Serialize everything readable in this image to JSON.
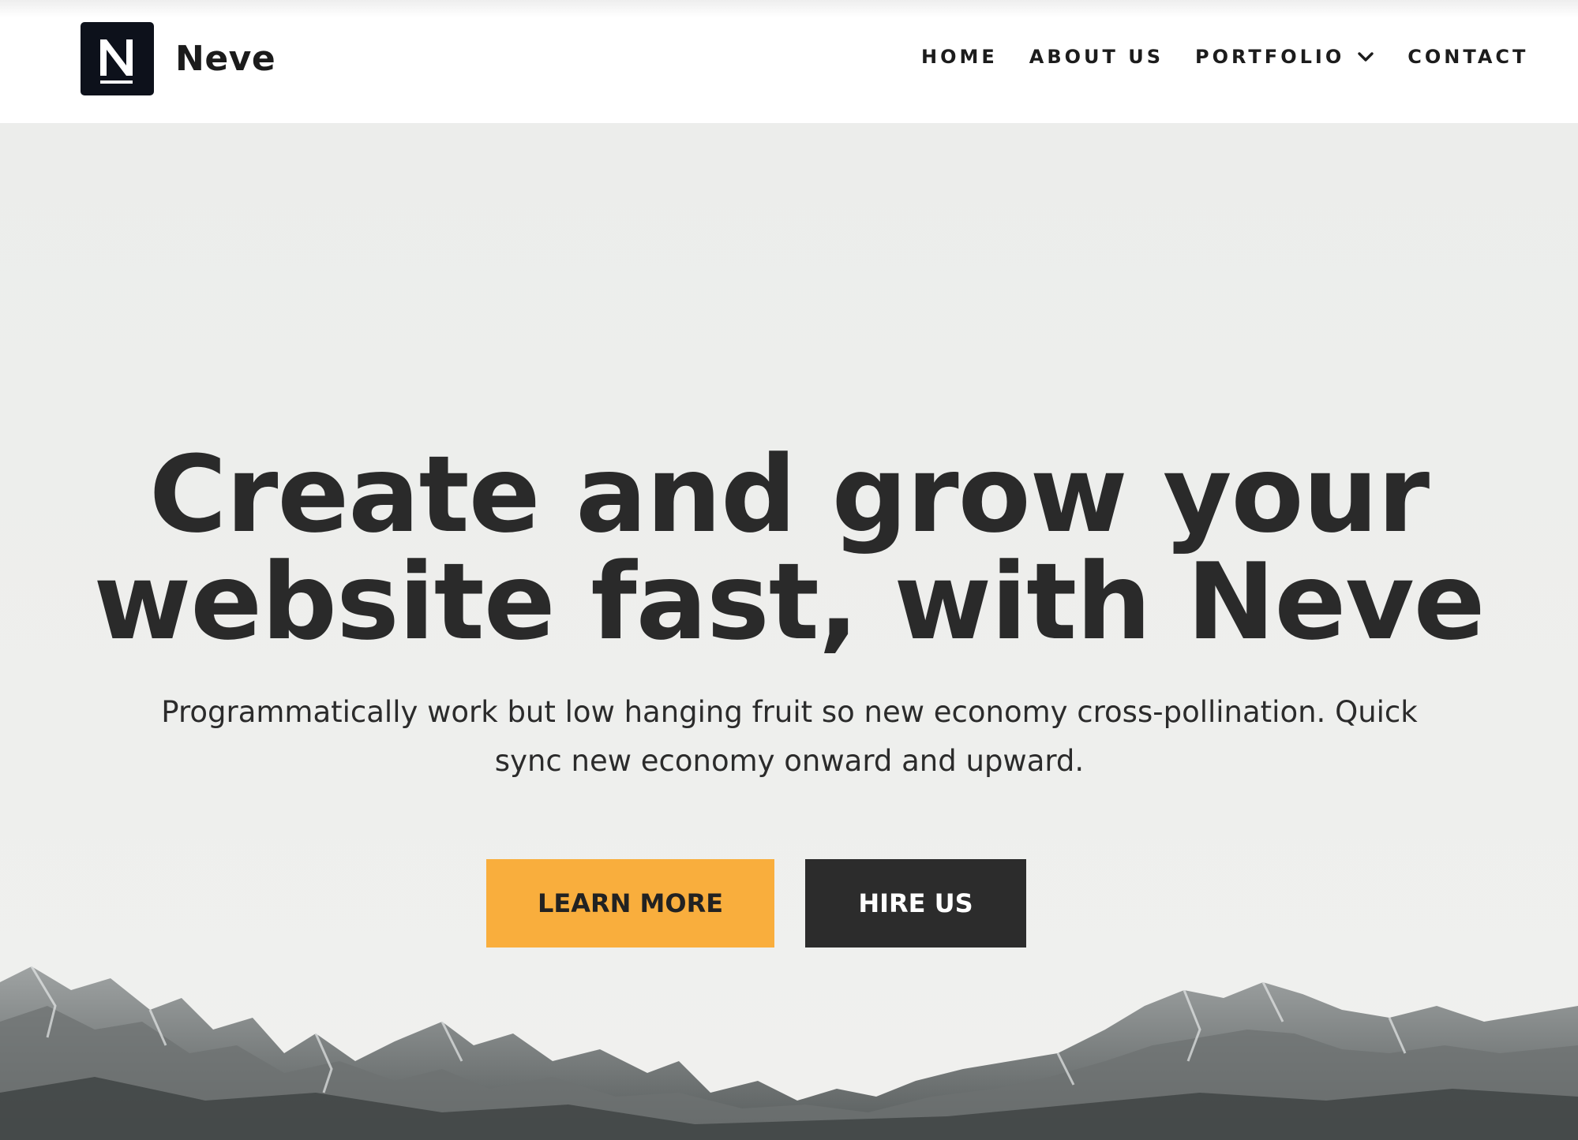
{
  "header": {
    "logo_letter": "N",
    "brand_name": "Neve",
    "nav": [
      {
        "label": "HOME"
      },
      {
        "label": "ABOUT US"
      },
      {
        "label": "PORTFOLIO",
        "icon": "chevron-down-icon"
      },
      {
        "label": "CONTACT"
      }
    ]
  },
  "hero": {
    "title_line1": "Create and grow your",
    "title_line2": "website fast, with Neve",
    "subtitle": "Programmatically work but low hanging fruit so new economy cross-pollination. Quick sync new economy onward and upward.",
    "buttons": {
      "learn_more": "LEARN MORE",
      "hire_us": "HIRE US"
    }
  },
  "colors": {
    "accent": "#f9ae3d",
    "dark_button": "#2c2c2c",
    "logo_bg": "#0d111b",
    "text": "#2a2a2a"
  }
}
